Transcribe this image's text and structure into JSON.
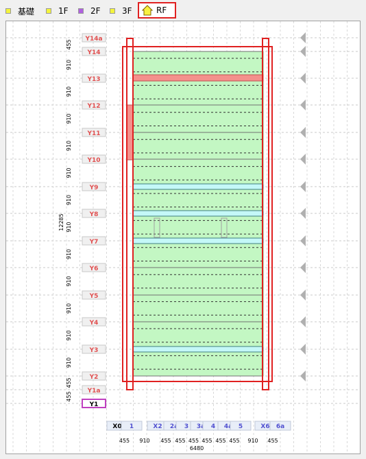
{
  "tabs": [
    {
      "label": "基礎",
      "color": "#f4f43c"
    },
    {
      "label": "1F",
      "color": "#f4f43c"
    },
    {
      "label": "2F",
      "color": "#b060e0"
    },
    {
      "label": "3F",
      "color": "#f4f43c"
    },
    {
      "label": "RF",
      "active": true
    }
  ],
  "grid_y": [
    {
      "label": "Y14a",
      "dim": "455"
    },
    {
      "label": "Y14",
      "dim": "910"
    },
    {
      "label": "Y13",
      "dim": "910"
    },
    {
      "label": "Y12",
      "dim": "910"
    },
    {
      "label": "Y11",
      "dim": "910"
    },
    {
      "label": "Y10",
      "dim": "910"
    },
    {
      "label": "Y9",
      "dim": "910"
    },
    {
      "label": "Y8",
      "dim": "910"
    },
    {
      "label": "Y7",
      "dim": "910"
    },
    {
      "label": "Y6",
      "dim": "910"
    },
    {
      "label": "Y5",
      "dim": "910"
    },
    {
      "label": "Y4",
      "dim": "910"
    },
    {
      "label": "Y3",
      "dim": "910"
    },
    {
      "label": "Y2",
      "dim": "455"
    },
    {
      "label": "Y1a",
      "dim": "455"
    },
    {
      "label": "Y1",
      "selected": true
    }
  ],
  "grid_x": [
    {
      "label": "X0",
      "dim": "455"
    },
    {
      "label": "1",
      "dim": "910"
    },
    {
      "label": "X2",
      "dim": "455"
    },
    {
      "label": "2a",
      "dim": "455"
    },
    {
      "label": "3",
      "dim": "455"
    },
    {
      "label": "3a",
      "dim": "455"
    },
    {
      "label": "4",
      "dim": "455"
    },
    {
      "label": "4a",
      "dim": "455"
    },
    {
      "label": "5",
      "dim": "910"
    },
    {
      "label": "X6",
      "dim": "455"
    },
    {
      "label": "6a"
    }
  ],
  "total_y": "12285",
  "total_x": "6480",
  "colors": {
    "roof": "#c3f7c3",
    "outline": "#e02020",
    "beam_pink": "#f4908c",
    "beam_cyan": "#c4f8f8",
    "label_text": "#e05050",
    "x_label": "#5050d0"
  }
}
